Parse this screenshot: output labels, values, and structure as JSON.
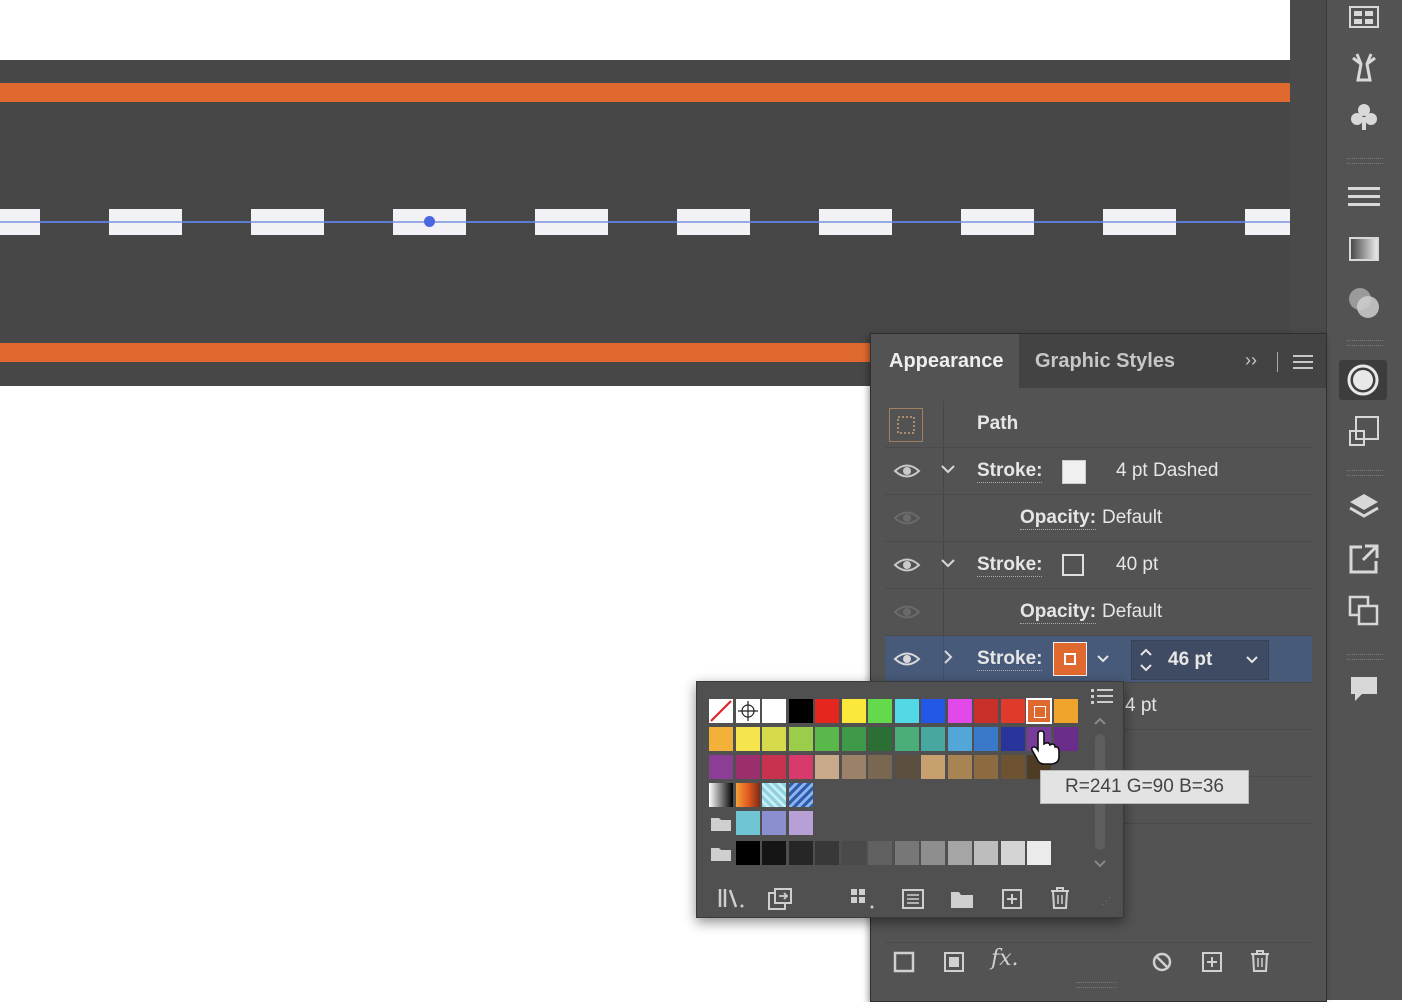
{
  "panel": {
    "tabs": [
      {
        "label": "Appearance",
        "active": true
      },
      {
        "label": "Graphic Styles",
        "active": false
      }
    ],
    "object_label": "Path",
    "rows": [
      {
        "type": "stroke",
        "label": "Stroke:",
        "value": "4 pt Dashed",
        "color": "#f0f0f0",
        "expanded": true
      },
      {
        "type": "opacity",
        "label": "Opacity:",
        "value": "Default"
      },
      {
        "type": "stroke",
        "label": "Stroke:",
        "value": "40 pt",
        "color": "none",
        "expanded": true
      },
      {
        "type": "opacity",
        "label": "Opacity:",
        "value": "Default"
      },
      {
        "type": "stroke",
        "label": "Stroke:",
        "value": "46 pt",
        "color": "#e0692f",
        "expanded": false,
        "selected": true
      },
      {
        "type": "stroke",
        "label": "",
        "value": "54 pt",
        "partial": "4 pt"
      }
    ]
  },
  "tooltip": {
    "text": "R=241 G=90 B=36"
  },
  "colors": {
    "canvas_road": "#474747",
    "road_edge": "#e0692f",
    "dash": "#f1f1f6",
    "selection": "#5b7bd6"
  },
  "icons": {
    "toolbar": [
      "libraries-icon",
      "puppet-warp-icon",
      "symbols-icon",
      "align-icon",
      "gradient-icon",
      "transparency-icon",
      "appearance-icon",
      "transform-icon",
      "layers-icon",
      "export-icon",
      "artboards-icon",
      "comments-icon"
    ],
    "panel_bottom": [
      "new-stroke-icon",
      "new-fill-icon",
      "fx-icon",
      "clear-appearance-icon",
      "duplicate-item-icon",
      "delete-item-icon"
    ],
    "popup_bottom": [
      "swatch-library-icon",
      "show-kinds-icon",
      "swatch-options-icon",
      "color-group-icon",
      "new-group-icon",
      "new-swatch-icon",
      "delete-swatch-icon"
    ]
  }
}
